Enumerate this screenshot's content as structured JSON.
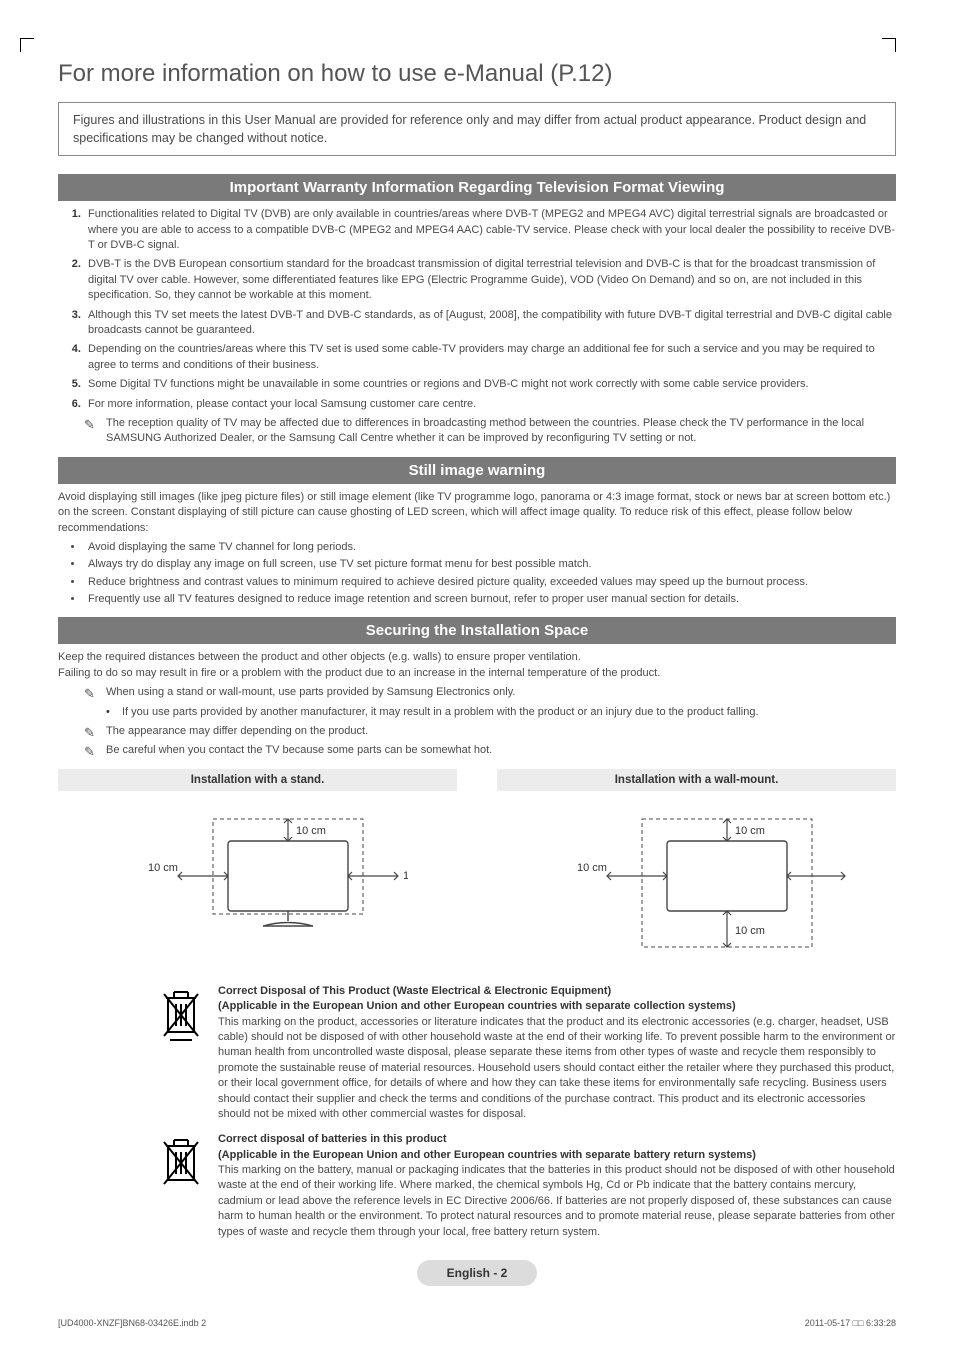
{
  "title": "For more information on how to use e-Manual (P.12)",
  "notice": "Figures and illustrations in this User Manual are provided for reference only and may differ from actual product appearance. Product design and specifications may be changed without notice.",
  "section1": {
    "heading": "Important Warranty Information Regarding Television Format Viewing",
    "items": [
      "Functionalities related to Digital TV (DVB) are only available in countries/areas where DVB-T (MPEG2 and MPEG4 AVC) digital terrestrial signals are broadcasted or where you are able to access to a compatible DVB-C (MPEG2 and MPEG4 AAC) cable-TV service. Please check with your local dealer the possibility to receive DVB-T or DVB-C signal.",
      "DVB-T is the DVB European consortium standard for the broadcast transmission of digital terrestrial television and DVB-C is that for the broadcast transmission of digital TV over cable. However, some differentiated features like EPG (Electric Programme Guide), VOD (Video On Demand) and so on, are not included in this specification. So, they cannot be workable at this moment.",
      "Although this TV set meets the latest DVB-T and DVB-C standards, as of [August, 2008], the compatibility with future DVB-T digital terrestrial and DVB-C digital cable broadcasts cannot be guaranteed.",
      "Depending on the countries/areas where this TV set is used some cable-TV providers may charge an additional fee for such a service and you may be required to agree to terms and conditions of their business.",
      "Some Digital TV functions might be unavailable in some countries or regions and DVB-C might not work correctly with some cable service providers.",
      "For more information, please contact your local Samsung customer care centre."
    ],
    "note": "The reception quality of TV may be affected due to differences in broadcasting method between the countries. Please check the TV performance in the local SAMSUNG Authorized Dealer, or the Samsung Call Centre whether it can be improved by reconfiguring TV setting or not."
  },
  "section2": {
    "heading": "Still image warning",
    "intro": "Avoid displaying still images (like jpeg picture files) or still image element (like TV programme logo, panorama or 4:3 image format, stock or news bar at screen bottom etc.) on the screen. Constant displaying of still picture can cause ghosting of LED screen, which will affect image quality. To reduce risk of this effect, please follow below recommendations:",
    "bullets": [
      "Avoid displaying the same TV channel for long periods.",
      "Always try do display any image on full screen, use TV set picture format menu for best possible match.",
      "Reduce brightness and contrast values to minimum required to achieve desired picture quality, exceeded values may speed up the burnout process.",
      "Frequently use all TV features designed to reduce image retention and screen burnout, refer to proper user manual section for details."
    ]
  },
  "section3": {
    "heading": "Securing the Installation Space",
    "p1": "Keep the required distances between the product and other objects (e.g. walls) to ensure proper ventilation.",
    "p2": "Failing to do so may result in fire or a problem with the product due to an increase in the internal temperature of the product.",
    "note1": "When using a stand or wall-mount, use parts provided by Samsung Electronics only.",
    "note1_sub": "If you use parts provided by another manufacturer, it may result in a problem with the product or an injury due to the product falling.",
    "note2": "The appearance may differ depending on the product.",
    "note3": "Be careful when you contact the TV because some parts can be somewhat hot.",
    "diag_stand": "Installation with a stand.",
    "diag_wall": "Installation with a wall-mount.",
    "dist": "10 cm"
  },
  "disposal1": {
    "h1": "Correct Disposal of This Product (Waste Electrical & Electronic Equipment)",
    "h2": "(Applicable in the European Union and other European countries with separate collection systems)",
    "body": "This marking on the product, accessories or literature indicates that the product and its electronic accessories (e.g. charger, headset, USB cable) should not be disposed of with other household waste at the end of their working life. To prevent possible harm to the environment or human health from uncontrolled waste disposal, please separate these items from other types of waste and recycle them responsibly to promote the sustainable reuse of material resources. Household users should contact either the retailer where they purchased this product, or their local government office, for details of where and how they can take these items for environmentally safe recycling. Business users should contact their supplier and check the terms and conditions of the purchase contract. This product and its electronic accessories should not be mixed with other commercial wastes for disposal."
  },
  "disposal2": {
    "h1": "Correct disposal of batteries in this product",
    "h2": "(Applicable in the European Union and other European countries with separate battery return systems)",
    "body": "This marking on the battery, manual or packaging indicates that the batteries in this product should not be disposed of with other household waste at the end of their working life. Where marked, the chemical symbols Hg, Cd or Pb indicate that the battery contains mercury, cadmium or lead above the reference levels in EC Directive 2006/66. If batteries are not properly disposed of, these substances can cause harm to human health or the environment. To protect natural resources and to promote material reuse, please separate batteries from other types of waste and recycle them through your local, free battery return system."
  },
  "footer": {
    "page": "English - 2",
    "file": "[UD4000-XNZF]BN68-03426E.indb   2",
    "timestamp": "2011-05-17   □□ 6:33:28"
  }
}
